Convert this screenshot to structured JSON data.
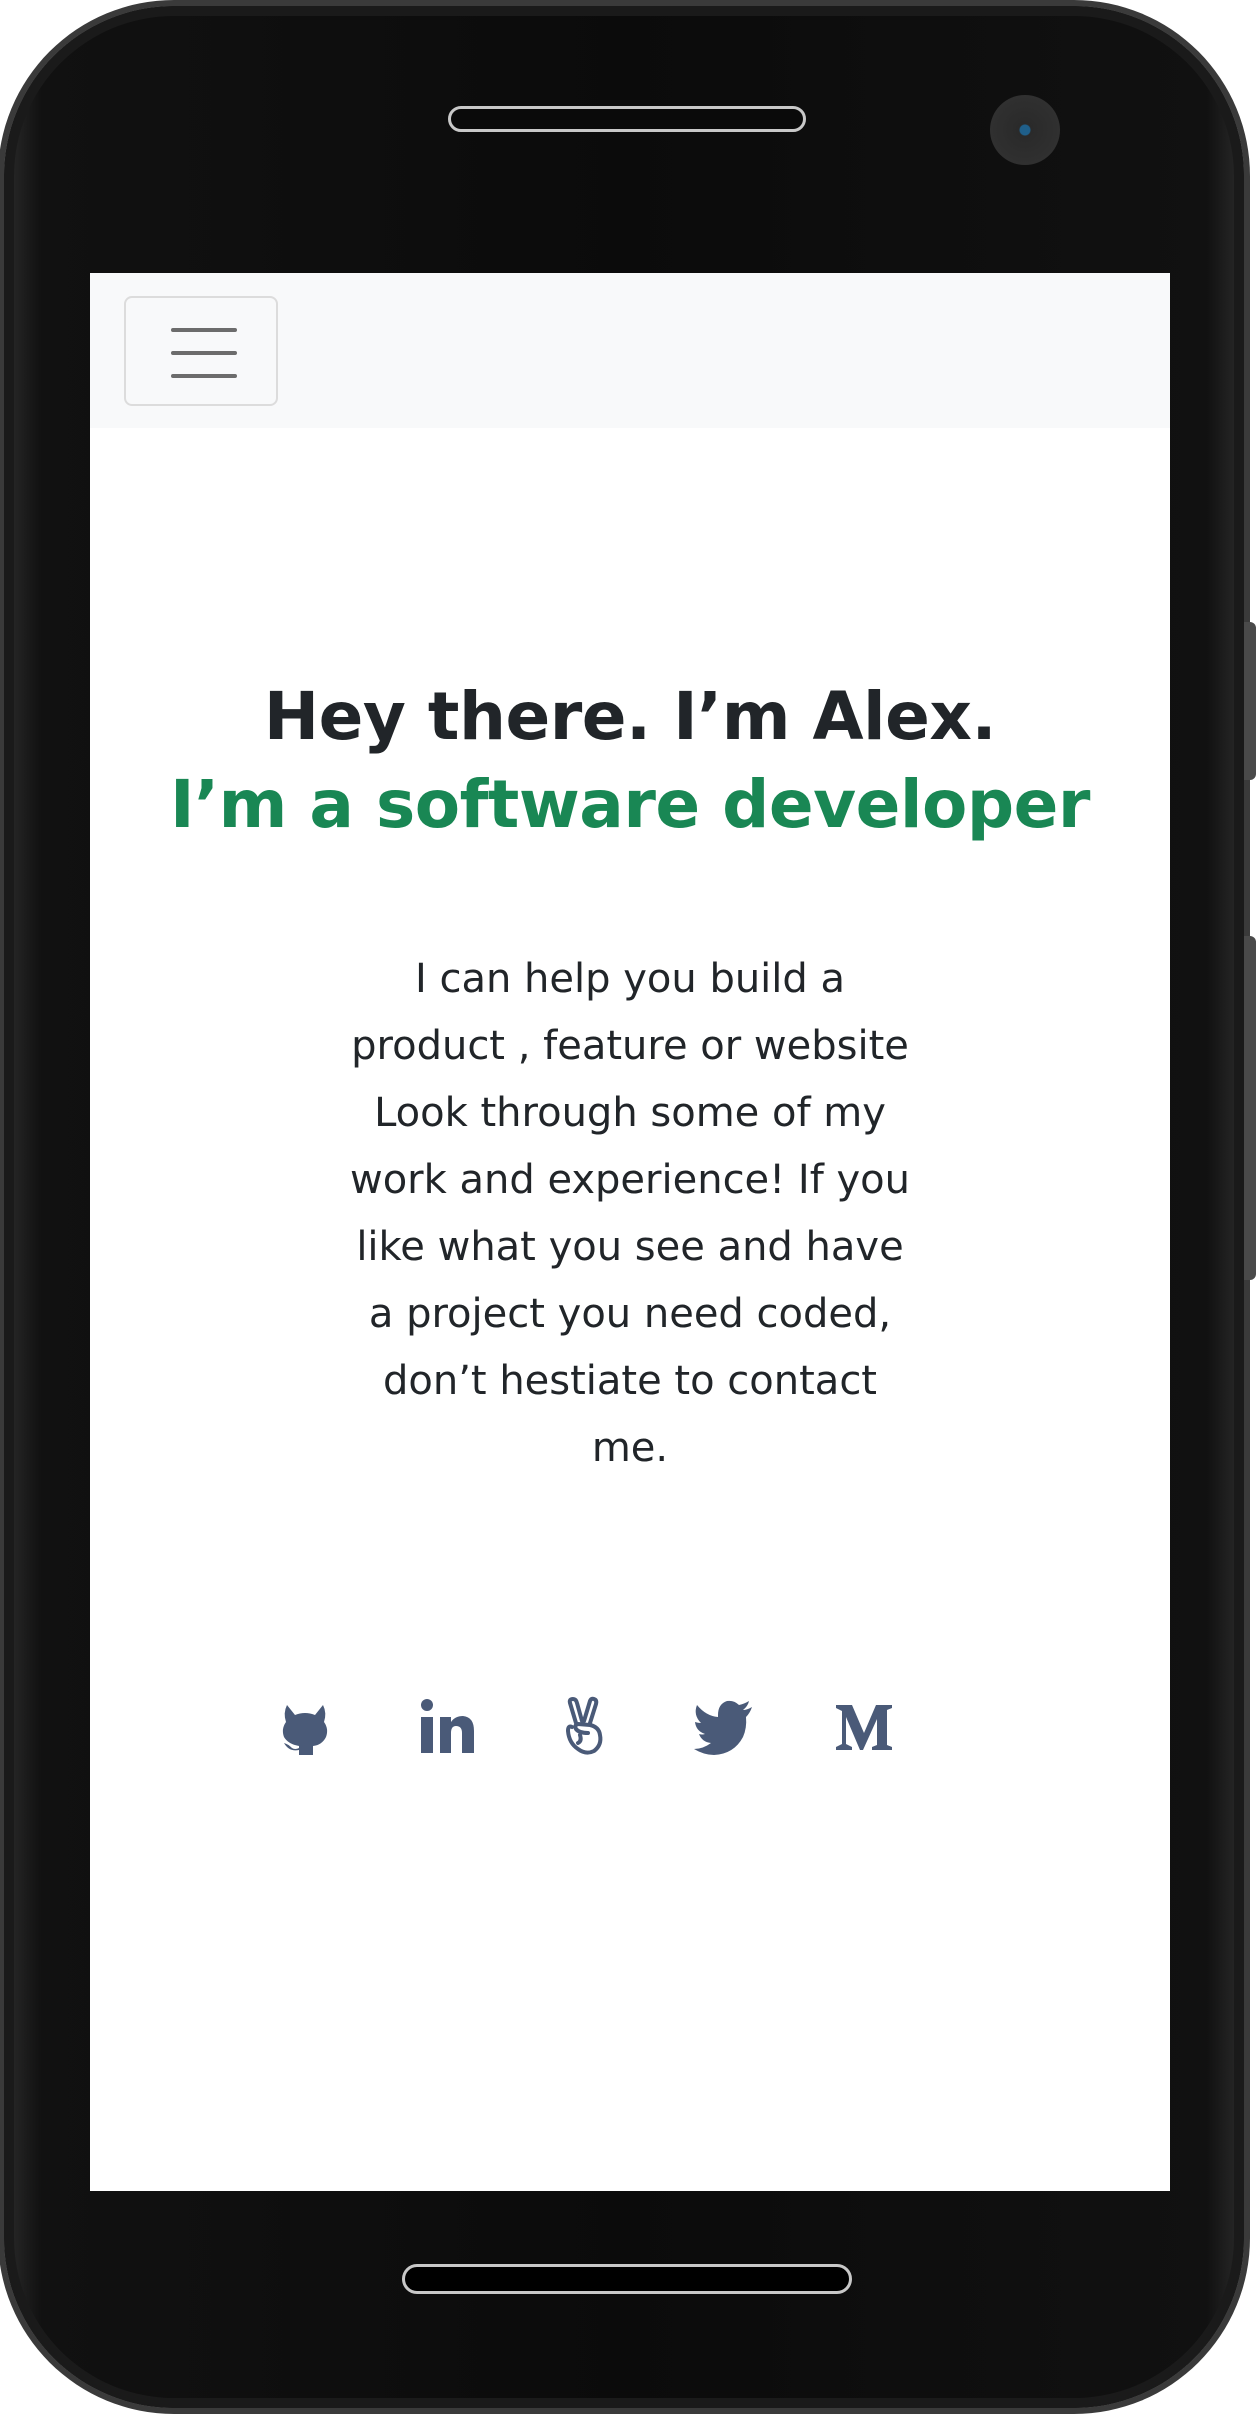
{
  "hero": {
    "greeting": "Hey there. I’m Alex.",
    "role": "I’m a software developer",
    "description": "I can help you build a product , feature or website Look through some of my work and experience! If you like what you see and have a project you need coded, don’t hestiate to contact me."
  },
  "social_links": [
    {
      "icon": "github-icon"
    },
    {
      "icon": "linkedin-icon"
    },
    {
      "icon": "angellist-icon"
    },
    {
      "icon": "twitter-icon"
    },
    {
      "icon": "medium-icon"
    }
  ],
  "colors": {
    "accent": "#198754",
    "heading": "#212529",
    "icon": "#4a5a78",
    "navbar_bg": "#f8f9fa"
  }
}
